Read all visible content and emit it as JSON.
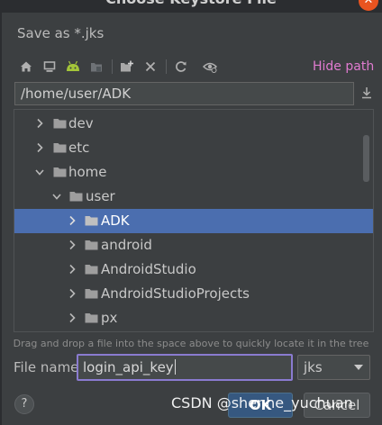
{
  "window": {
    "title": "Choose Keystore File"
  },
  "subtitle": "Save as *.jks",
  "toolbar": {
    "icons": [
      "home-icon",
      "desktop-icon",
      "android-icon",
      "project-folder-icon",
      "new-folder-icon",
      "delete-icon",
      "refresh-icon",
      "show-hidden-icon"
    ],
    "hide_path": "Hide path"
  },
  "path": {
    "value": "/home/user/ADK"
  },
  "tree": {
    "rows": [
      {
        "label": "dev",
        "expanded": false,
        "selected": false
      },
      {
        "label": "etc",
        "expanded": false,
        "selected": false
      },
      {
        "label": "home",
        "expanded": true,
        "selected": false
      },
      {
        "label": "user",
        "expanded": true,
        "selected": false
      },
      {
        "label": "ADK",
        "expanded": false,
        "selected": true
      },
      {
        "label": "android",
        "expanded": false,
        "selected": false
      },
      {
        "label": "AndroidStudio",
        "expanded": false,
        "selected": false
      },
      {
        "label": "AndroidStudioProjects",
        "expanded": false,
        "selected": false
      },
      {
        "label": "px",
        "expanded": false,
        "selected": false
      }
    ]
  },
  "hint": "Drag and drop a file into the space above to quickly locate it in the tree",
  "file_name": {
    "label": "File name:",
    "value": "login_api_key"
  },
  "extension": {
    "selected": "jks"
  },
  "buttons": {
    "help": "?",
    "ok": "OK",
    "cancel": "Cancel"
  },
  "watermark": "CSDN @shenhe_yuchuan",
  "colors": {
    "accent": "#4b6eaf",
    "link": "#e07bd0",
    "focus_border": "#8a7bd0",
    "android_green": "#a4c639"
  }
}
